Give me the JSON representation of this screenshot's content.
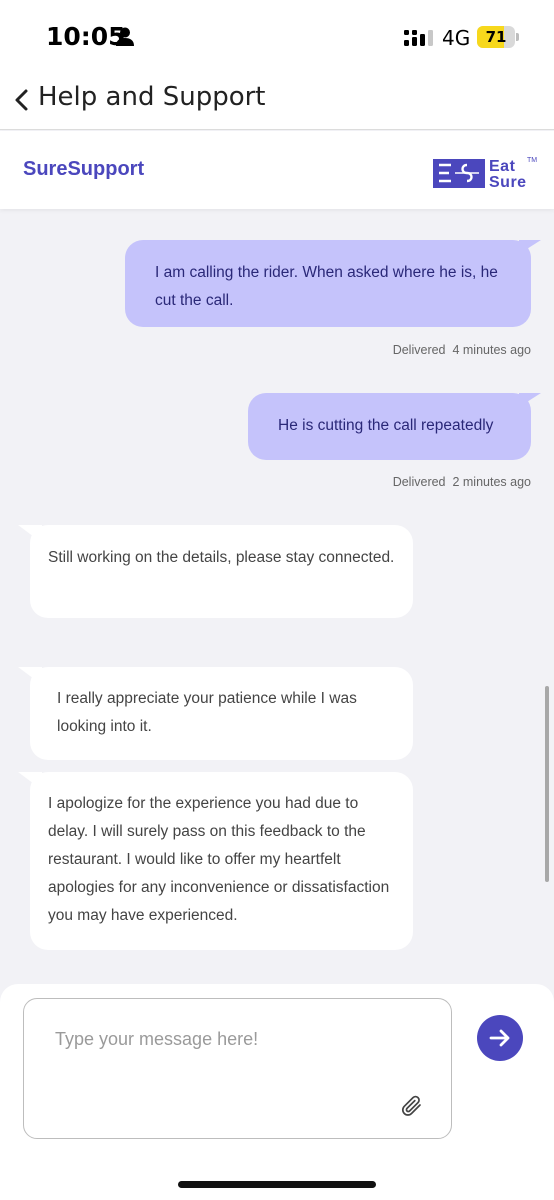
{
  "status_bar": {
    "time": "10:05",
    "network": "4G",
    "battery": "71",
    "battery_level": 0.71,
    "battery_color": "#f7d81c"
  },
  "header": {
    "title": "Help and Support",
    "back_icon": "chevron-left-icon"
  },
  "brand": {
    "name": "SureSupport",
    "logo_line1": "Eat",
    "logo_line2": "Sure",
    "logo_tm": "TM",
    "accent_color": "#4b47bd"
  },
  "messages": [
    {
      "direction": "outgoing",
      "text": "I am calling the rider. When asked where he is, he cut the call.",
      "status": "Delivered",
      "time": "4 minutes ago"
    },
    {
      "direction": "outgoing",
      "text": "He is cutting the call repeatedly",
      "status": "Delivered",
      "time": "2 minutes ago"
    },
    {
      "direction": "incoming",
      "text": "Still working on the details, please stay connected."
    },
    {
      "direction": "incoming",
      "text": "I really appreciate your patience while I was looking into it."
    },
    {
      "direction": "incoming",
      "text": "I apologize for the experience you had due to delay. I will surely pass on this feedback to the restaurant. I would like to offer my heartfelt apologies for any inconvenience or dissatisfaction you may have experienced."
    }
  ],
  "composer": {
    "placeholder": "Type your message here!",
    "value": "",
    "attach_icon": "paperclip-icon",
    "send_icon": "arrow-right-icon"
  }
}
